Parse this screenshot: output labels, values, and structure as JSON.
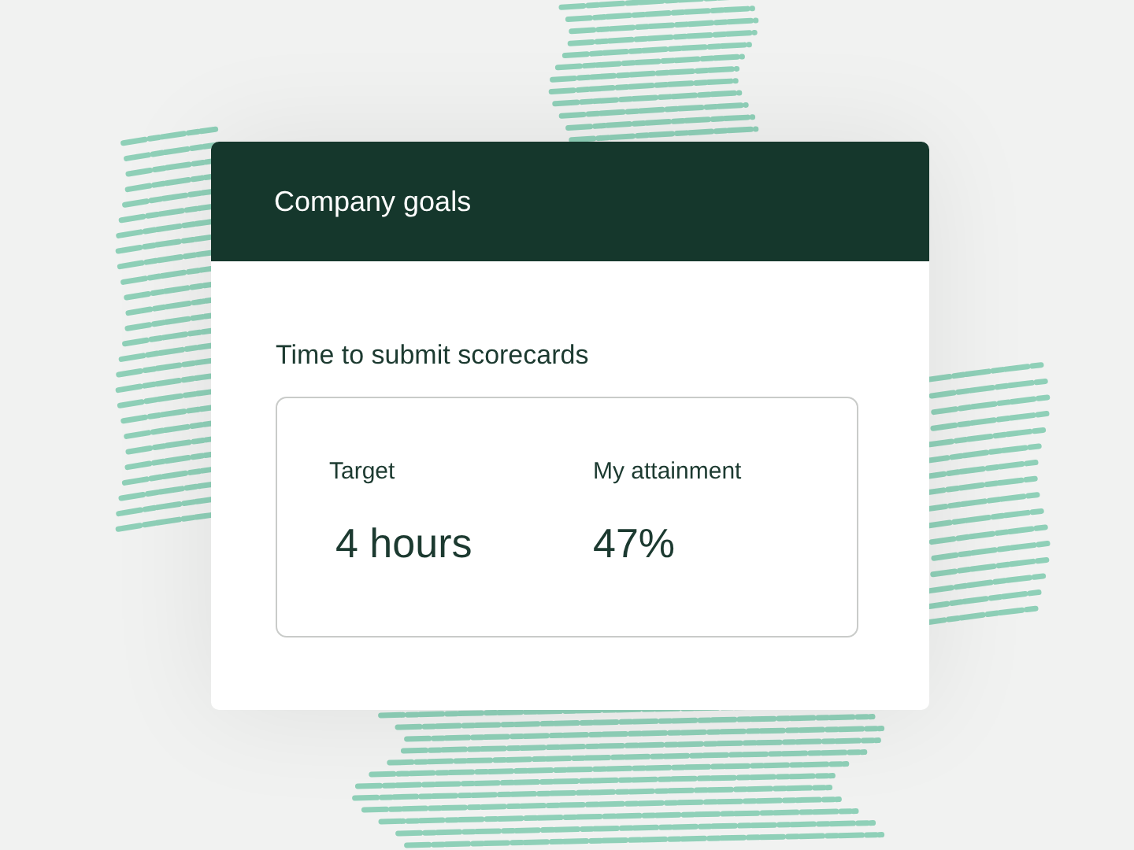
{
  "card": {
    "title": "Company goals",
    "metric_name": "Time to submit scorecards",
    "fields": [
      {
        "label": "Target",
        "value": "4 hours"
      },
      {
        "label": "My attainment",
        "value": "47%"
      }
    ]
  }
}
